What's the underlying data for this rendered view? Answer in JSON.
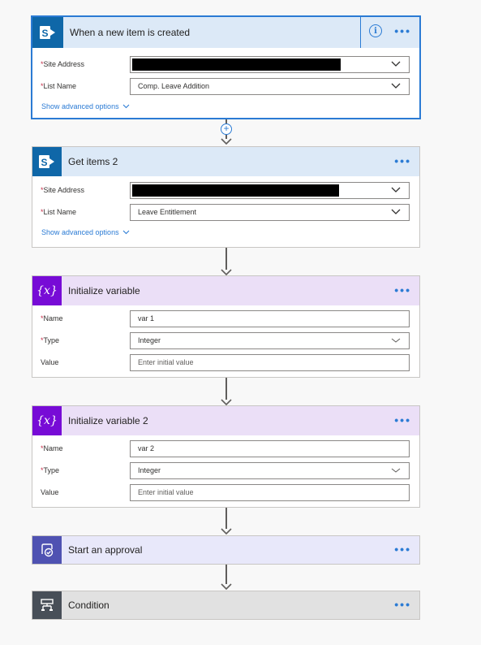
{
  "colors": {
    "accent": "#2b7bd4",
    "sharepoint": "#0f67a8",
    "variable": "#770bd6",
    "approval": "#4f52b2",
    "condition": "#484f58",
    "required": "#c4314b"
  },
  "trigger": {
    "title": "When a new item is created",
    "icon": "sharepoint-icon",
    "fields": [
      {
        "label": "Site Address",
        "value": "",
        "redacted": true
      },
      {
        "label": "List Name",
        "value": "Comp. Leave Addition"
      }
    ],
    "advanced_label": "Show advanced options"
  },
  "get_items": {
    "title": "Get items 2",
    "icon": "sharepoint-icon",
    "fields": [
      {
        "label": "Site Address",
        "value": "",
        "redacted": true
      },
      {
        "label": "List Name",
        "value": "Leave Entitlement"
      }
    ],
    "advanced_label": "Show advanced options"
  },
  "init_var1": {
    "title": "Initialize variable",
    "icon": "variable-icon",
    "icon_text": "{x}",
    "name_label": "Name",
    "name_value": "var 1",
    "type_label": "Type",
    "type_value": "Integer",
    "value_label": "Value",
    "value_placeholder": "Enter initial value"
  },
  "init_var2": {
    "title": "Initialize variable 2",
    "icon": "variable-icon",
    "icon_text": "{x}",
    "name_label": "Name",
    "name_value": "var 2",
    "type_label": "Type",
    "type_value": "Integer",
    "value_label": "Value",
    "value_placeholder": "Enter initial value"
  },
  "approval": {
    "title": "Start an approval",
    "icon": "approval-icon"
  },
  "condition": {
    "title": "Condition",
    "icon": "condition-icon"
  },
  "menu_label": "•••",
  "required_mark": "*",
  "info_label": "i"
}
